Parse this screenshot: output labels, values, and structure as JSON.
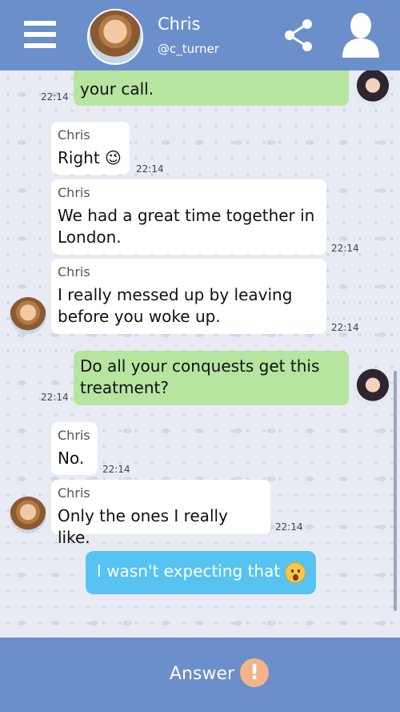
{
  "header": {
    "name": "Chris",
    "handle": "@c_turner"
  },
  "messages": [
    {
      "side": "out",
      "text": "your call.",
      "time": "22:14"
    },
    {
      "side": "in",
      "sender": "Chris",
      "text": "Right 😉",
      "time": "22:14"
    },
    {
      "side": "in",
      "sender": "Chris",
      "text": "We had a great time together in London.",
      "time": "22:14"
    },
    {
      "side": "in",
      "sender": "Chris",
      "text": "I really messed up by leaving before you woke up.",
      "time": "22:14"
    },
    {
      "side": "out",
      "text": "Do all your conquests get this treatment?",
      "time": "22:14"
    },
    {
      "side": "in",
      "sender": "Chris",
      "text": "No.",
      "time": "22:14"
    },
    {
      "side": "in",
      "sender": "Chris",
      "text": "Only the ones I really like.",
      "time": "22:14"
    }
  ],
  "choice": {
    "text": "I wasn't expecting that"
  },
  "footer": {
    "answer_label": "Answer",
    "alert_symbol": "!"
  },
  "colors": {
    "header": "#6a8fca",
    "outgoing_bubble": "#b6e5a0",
    "incoming_bubble": "#ffffff",
    "choice_bubble": "#56c3f3",
    "alert": "#f3b48a"
  }
}
